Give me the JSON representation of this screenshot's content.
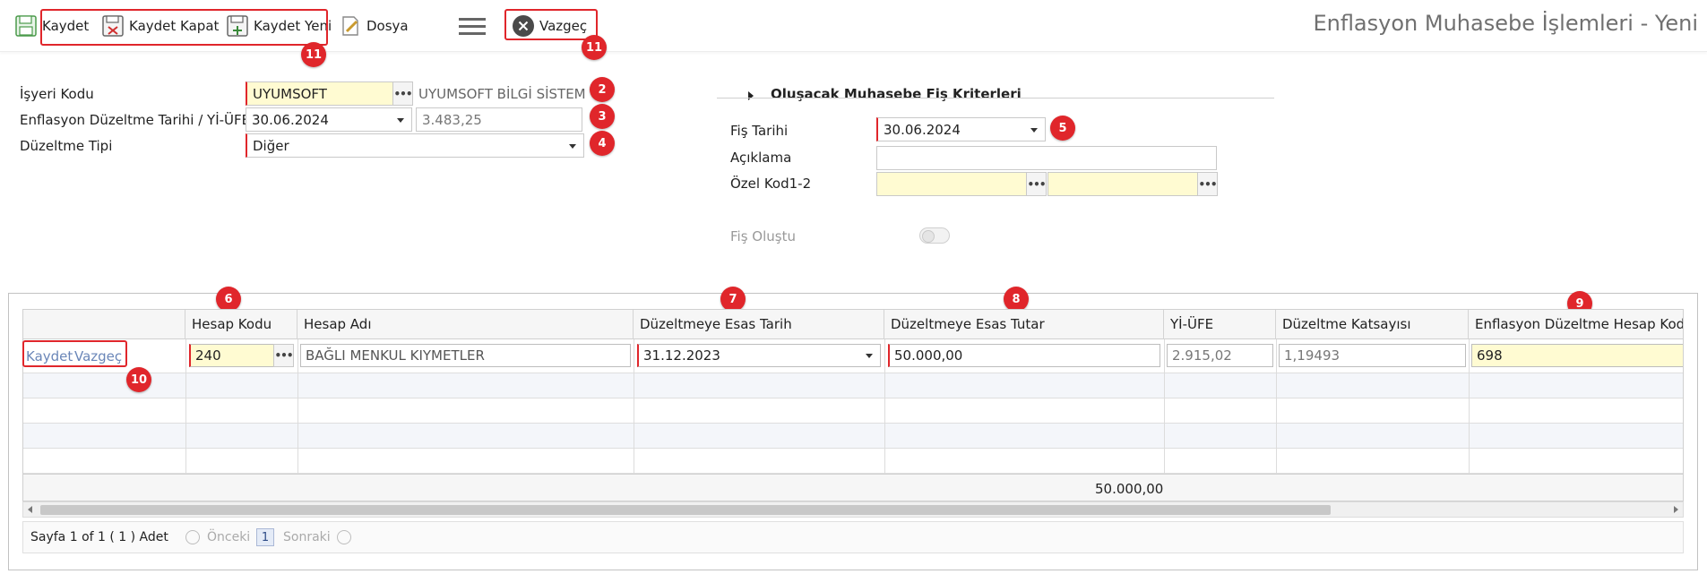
{
  "toolbar": {
    "save_label": "Kaydet",
    "save_close_label": "Kaydet Kapat",
    "save_new_label": "Kaydet Yeni",
    "file_label": "Dosya",
    "cancel_label": "Vazgeç"
  },
  "page_title": "Enflasyon Muhasebe İşlemleri - Yeni",
  "form": {
    "employer_code_label": "İşyeri Kodu",
    "employer_code_value": "UYUMSOFT",
    "employer_name": "UYUMSOFT BİLGİ SİSTEM",
    "correction_date_label": "Enflasyon Düzeltme Tarihi / Yİ-ÜFE",
    "correction_date_value": "30.06.2024",
    "yiufe_value": "3.483,25",
    "correction_type_label": "Düzeltme Tipi",
    "correction_type_value": "Diğer"
  },
  "voucher": {
    "section_title": "Oluşacak Muhasebe Fiş Kriterleri",
    "date_label": "Fiş Tarihi",
    "date_value": "30.06.2024",
    "description_label": "Açıklama",
    "description_value": "",
    "special_code_label": "Özel Kod1-2",
    "special_code1_value": "",
    "special_code2_value": "",
    "created_label": "Fiş Oluştu",
    "created_value": false
  },
  "grid": {
    "columns": [
      "",
      "Hesap Kodu",
      "Hesap Adı",
      "Düzeltmeye Esas Tarih",
      "Düzeltmeye Esas Tutar",
      "Yİ-ÜFE",
      "Düzeltme Katsayısı",
      "Enflasyon Düzeltme Hesap Kodu"
    ],
    "row_actions": {
      "save": "Kaydet",
      "cancel": "Vazgeç"
    },
    "edit_row": {
      "account_code": "240",
      "account_name": "BAĞLI MENKUL KIYMETLER",
      "base_date": "31.12.2023",
      "base_amount": "50.000,00",
      "yiufe": "2.915,02",
      "coefficient": "1,19493",
      "inflation_account_code": "698"
    },
    "total_amount": "50.000,00"
  },
  "pager": {
    "text": "Sayfa 1 of 1 ( 1 ) Adet",
    "prev_label": "Önceki",
    "current_page": "1",
    "next_label": "Sonraki"
  },
  "annotations": {
    "b2": "2",
    "b3": "3",
    "b4": "4",
    "b5": "5",
    "b6": "6",
    "b7": "7",
    "b8": "8",
    "b9": "9",
    "b10": "10",
    "b11a": "11",
    "b11b": "11"
  },
  "colors": {
    "annotation_red": "#e0262b",
    "required_yellow": "#fffbd2",
    "link_blue": "#6a86b8"
  }
}
